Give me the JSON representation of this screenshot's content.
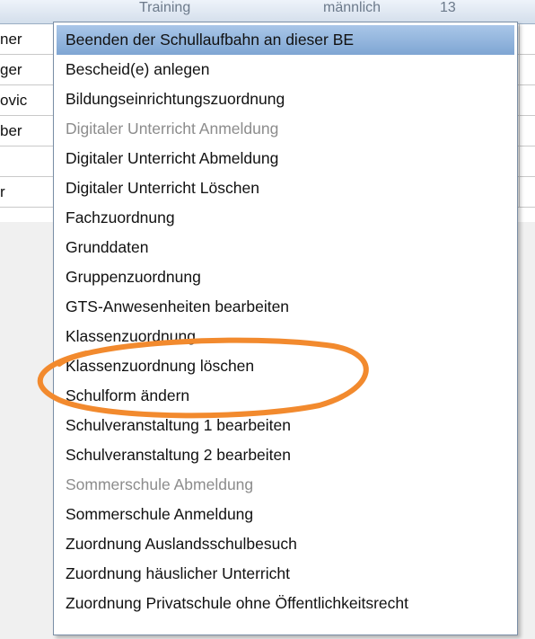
{
  "header": {
    "col_a": "Training",
    "col_b": "männlich",
    "col_c": "13"
  },
  "rows": [
    {
      "label": "ner"
    },
    {
      "label": "ger"
    },
    {
      "label": "ovic"
    },
    {
      "label": "ber"
    },
    {
      "label": ""
    },
    {
      "label": "r"
    }
  ],
  "menu": {
    "items": [
      {
        "label": "Beenden der Schullaufbahn an dieser BE",
        "state": "highlighted"
      },
      {
        "label": "Bescheid(e) anlegen",
        "state": "enabled"
      },
      {
        "label": "Bildungseinrichtungszuordnung",
        "state": "enabled"
      },
      {
        "label": "Digitaler Unterricht Anmeldung",
        "state": "disabled"
      },
      {
        "label": "Digitaler Unterricht Abmeldung",
        "state": "enabled"
      },
      {
        "label": "Digitaler Unterricht Löschen",
        "state": "enabled"
      },
      {
        "label": "Fachzuordnung",
        "state": "enabled"
      },
      {
        "label": "Grunddaten",
        "state": "enabled"
      },
      {
        "label": "Gruppenzuordnung",
        "state": "enabled"
      },
      {
        "label": "GTS-Anwesenheiten bearbeiten",
        "state": "enabled"
      },
      {
        "label": "Klassenzuordnung",
        "state": "enabled"
      },
      {
        "label": "Klassenzuordnung löschen",
        "state": "enabled"
      },
      {
        "label": "Schulform ändern",
        "state": "enabled"
      },
      {
        "label": "Schulveranstaltung 1 bearbeiten",
        "state": "enabled"
      },
      {
        "label": "Schulveranstaltung 2 bearbeiten",
        "state": "enabled"
      },
      {
        "label": "Sommerschule Abmeldung",
        "state": "disabled"
      },
      {
        "label": "Sommerschule Anmeldung",
        "state": "enabled"
      },
      {
        "label": "Zuordnung Auslandsschulbesuch",
        "state": "enabled"
      },
      {
        "label": "Zuordnung häuslicher Unterricht",
        "state": "enabled"
      },
      {
        "label": "Zuordnung Privatschule ohne Öffentlichkeitsrecht",
        "state": "enabled"
      }
    ]
  },
  "colors": {
    "highlight": "#7fa6d3",
    "annotation": "#f28a2e",
    "disabled_text": "#8c8c8c"
  }
}
